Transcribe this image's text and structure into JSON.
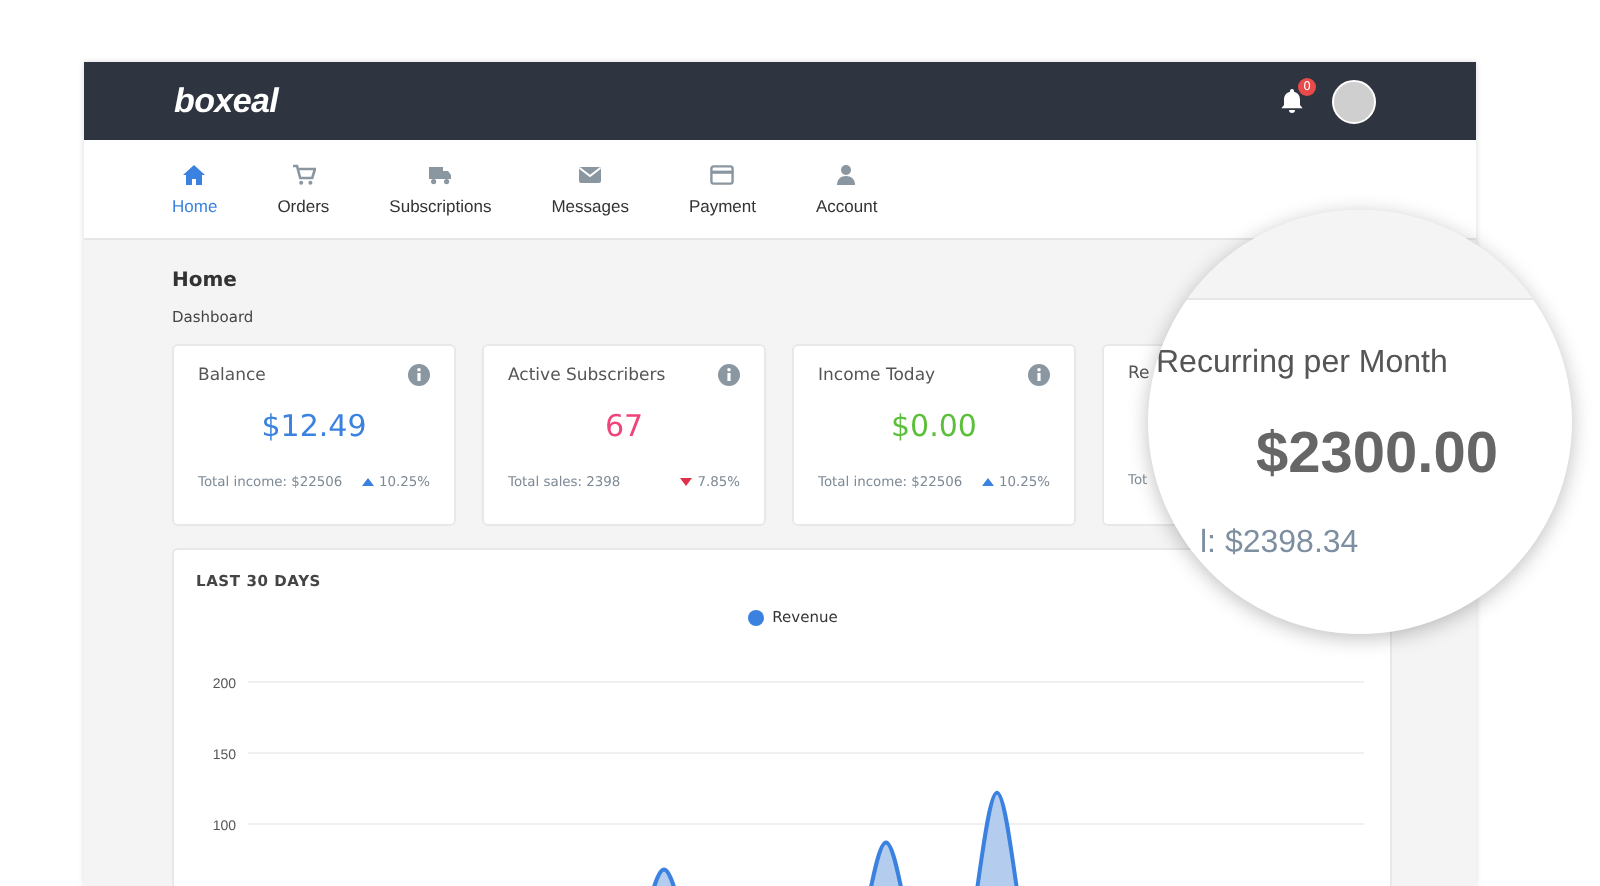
{
  "header": {
    "logo": "boxeal",
    "notification_count": "0"
  },
  "nav": [
    {
      "label": "Home",
      "selected": true
    },
    {
      "label": "Orders",
      "selected": false
    },
    {
      "label": "Subscriptions",
      "selected": false
    },
    {
      "label": "Messages",
      "selected": false
    },
    {
      "label": "Payment",
      "selected": false
    },
    {
      "label": "Account",
      "selected": false
    }
  ],
  "page": {
    "title": "Home",
    "breadcrumb": "Dashboard"
  },
  "cards": [
    {
      "title": "Balance",
      "value": "$12.49",
      "color": "#3b82e0",
      "footer": "Total income: $22506",
      "rising": true,
      "change": "10.25%"
    },
    {
      "title": "Active Subscribers",
      "value": "67",
      "color": "#f0447a",
      "footer": "Total sales: 2398",
      "rising": false,
      "change": "7.85%"
    },
    {
      "title": "Income Today",
      "value": "$0.00",
      "color": "#5cbf3c",
      "footer": "Total income: $22506",
      "rising": true,
      "change": "10.25%"
    },
    {
      "title": "Re",
      "footer": "Tot"
    }
  ],
  "chart_panel": {
    "title": "LAST 30 DAYS",
    "chart_data": {
      "type": "area",
      "ylim": [
        0,
        200
      ],
      "yticks": [
        100,
        150,
        200
      ],
      "series": [
        {
          "name": "Revenue",
          "color": "#3b82e0",
          "values": [
            0,
            0,
            0,
            0,
            0,
            0,
            0,
            0,
            0,
            0,
            0,
            68,
            0,
            0,
            0,
            0,
            0,
            87,
            0,
            0,
            122,
            0,
            0,
            0,
            0,
            0,
            0,
            0,
            0,
            0
          ]
        }
      ]
    }
  },
  "magnifier": {
    "title": "Recurring per Month",
    "value": "$2300.00",
    "footer": "l: $2398.34"
  }
}
